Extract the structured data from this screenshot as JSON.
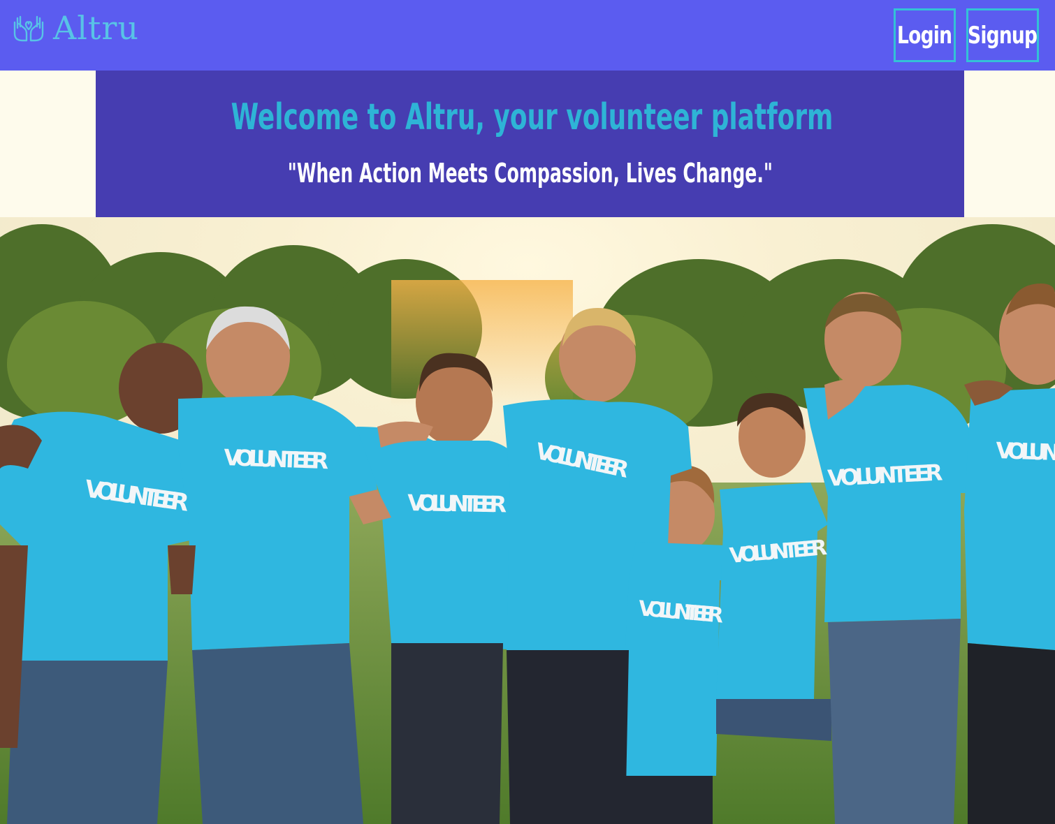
{
  "navbar": {
    "brand": "Altru",
    "logo_icon": "hands-heart-icon",
    "login_label": "Login",
    "signup_label": "Signup",
    "background_color": "#5b5cf0",
    "accent_color": "#33c2d6"
  },
  "hero": {
    "title": "Welcome to Altru, your volunteer platform",
    "quote": "\"When Action Meets Compassion, Lives Change.\"",
    "background_color": "#463db1",
    "title_color": "#2eb4d6"
  },
  "photo": {
    "shirt_label": "VOLUNTEER",
    "shirt_color": "#2fb7e0"
  }
}
